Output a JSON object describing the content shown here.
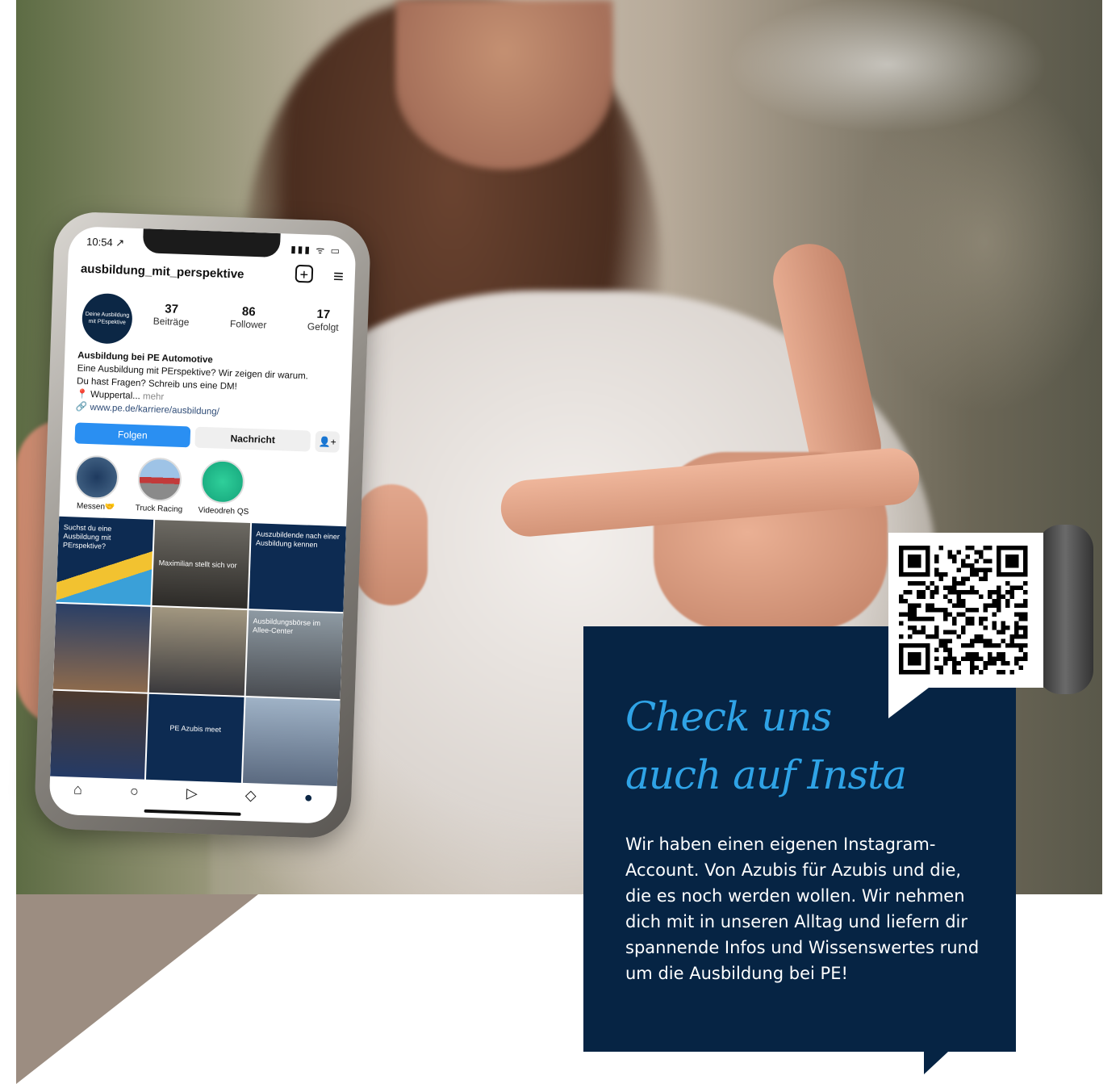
{
  "phone": {
    "status_time": "10:54 ↗",
    "status_icons": "▮▮▮ ᯤ ▭",
    "username": "ausbildung_mit_perspektive",
    "avatar_text": "Deine Ausbildung mit PEspektive",
    "stats": [
      {
        "num": "37",
        "label": "Beiträge"
      },
      {
        "num": "86",
        "label": "Follower"
      },
      {
        "num": "17",
        "label": "Gefolgt"
      }
    ],
    "bio_name": "Ausbildung bei PE Automotive",
    "bio_line1": "Eine Ausbildung mit PErspektive? Wir zeigen dir warum.",
    "bio_line2": "Du hast Fragen? Schreib uns eine DM!",
    "bio_location": "📍 Wuppertal...",
    "bio_more": " mehr",
    "bio_link": "🔗 www.pe.de/karriere/ausbildung/",
    "follow_label": "Folgen",
    "message_label": "Nachricht",
    "suggest_icon": "👤+",
    "highlights": [
      {
        "label": "Messen🤝"
      },
      {
        "label": "Truck Racing"
      },
      {
        "label": "Videodreh QS"
      }
    ],
    "grid_tiles": [
      {
        "text": "Suchst du eine Ausbildung mit PErspektive?"
      },
      {
        "text": "Maximilian stellt sich vor"
      },
      {
        "text": "Auszubildende nach einer Ausbildung kennen"
      },
      {
        "text": ""
      },
      {
        "text": ""
      },
      {
        "text": "Ausbildungsbörse im Allee-Center"
      },
      {
        "text": ""
      },
      {
        "text": "PE Azubis meet"
      },
      {
        "text": ""
      }
    ],
    "nav_icons": [
      "⌂",
      "○",
      "▷",
      "◇",
      "●"
    ]
  },
  "info": {
    "headline_line1": "Check uns",
    "headline_line2": "auch auf Insta",
    "body": "Wir haben einen eigenen Instagram-Account. Von Azubis für Azubis und die, die es noch werden wollen. Wir nehmen dich mit in unseren Alltag und liefern dir spannende Infos und Wissenswertes rund um die Ausbildung bei PE!"
  },
  "colors": {
    "navy": "#062444",
    "accent_blue": "#2fa3e6",
    "follow_blue": "#2a8ff2"
  }
}
